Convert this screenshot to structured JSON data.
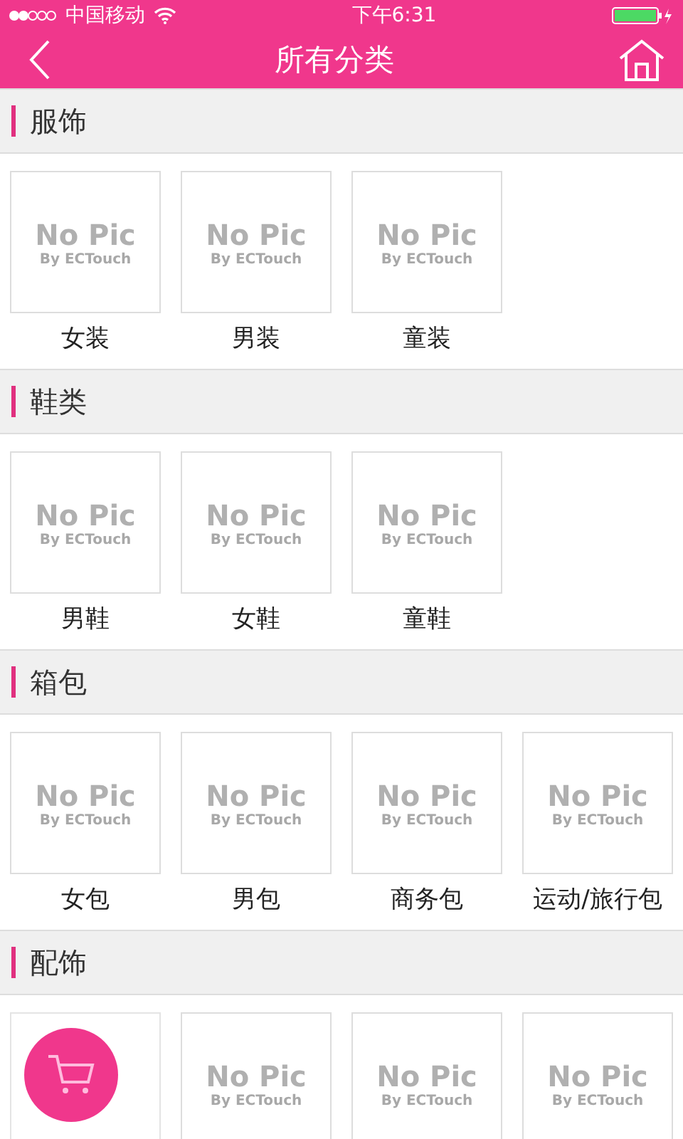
{
  "status_bar": {
    "carrier": "中国移动",
    "time": "下午6:31"
  },
  "nav": {
    "title": "所有分类"
  },
  "sections": [
    {
      "title": "服饰",
      "items": [
        {
          "label": "女装",
          "placeholder": [
            "No Pic",
            "By ECTouch"
          ]
        },
        {
          "label": "男装",
          "placeholder": [
            "No Pic",
            "By ECTouch"
          ]
        },
        {
          "label": "童装",
          "placeholder": [
            "No Pic",
            "By ECTouch"
          ]
        }
      ]
    },
    {
      "title": "鞋类",
      "items": [
        {
          "label": "男鞋",
          "placeholder": [
            "No Pic",
            "By ECTouch"
          ]
        },
        {
          "label": "女鞋",
          "placeholder": [
            "No Pic",
            "By ECTouch"
          ]
        },
        {
          "label": "童鞋",
          "placeholder": [
            "No Pic",
            "By ECTouch"
          ]
        }
      ]
    },
    {
      "title": "箱包",
      "items": [
        {
          "label": "女包",
          "placeholder": [
            "No Pic",
            "By ECTouch"
          ]
        },
        {
          "label": "男包",
          "placeholder": [
            "No Pic",
            "By ECTouch"
          ]
        },
        {
          "label": "商务包",
          "placeholder": [
            "No Pic",
            "By ECTouch"
          ]
        },
        {
          "label": "运动/旅行包",
          "placeholder": [
            "No Pic",
            "By ECTouch"
          ]
        }
      ]
    },
    {
      "title": "配饰",
      "items": [
        {
          "kind": "covered"
        },
        {
          "placeholder": [
            "No Pic",
            "By ECTouch"
          ]
        },
        {
          "placeholder": [
            "No Pic",
            "By ECTouch"
          ]
        },
        {
          "placeholder": [
            "No Pic",
            "By ECTouch"
          ]
        }
      ]
    }
  ]
}
